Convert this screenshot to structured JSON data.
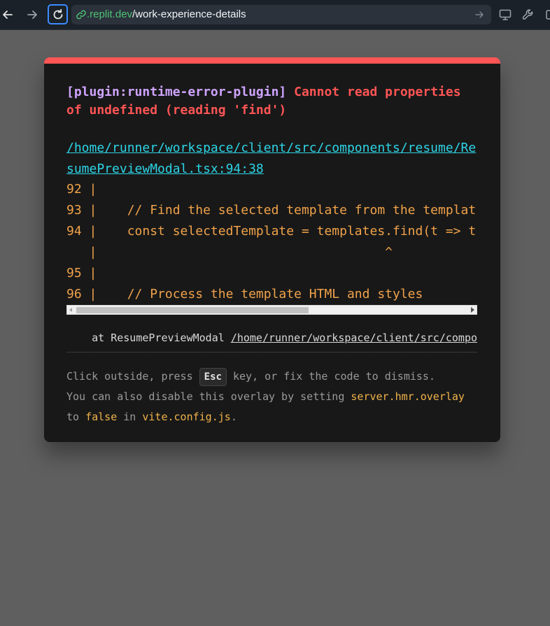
{
  "browser": {
    "url_host": ".replit.dev",
    "url_path": "/work-experience-details"
  },
  "overlay": {
    "plugin": "[plugin:runtime-error-plugin]",
    "message": "Cannot read properties of undefined (reading 'find')",
    "file": "/home/runner/workspace/client/src/components/resume/ResumePreviewModal.tsx:94:38",
    "code_frame": [
      "92 |",
      "93 |    // Find the selected template from the templat",
      "94 |    const selectedTemplate = templates.find(t => t",
      "   |                                      ^",
      "95 |",
      "96 |    // Process the template HTML and styles"
    ],
    "stack_prefix": "    at ResumePreviewModal ",
    "stack_file": "/home/runner/workspace/client/src/compor",
    "tip_line1_pre": "Click outside, press ",
    "tip_key": "Esc",
    "tip_line1_post": " key, or fix the code to dismiss.",
    "tip_line2_pre": "You can also disable this overlay by setting ",
    "tip_setting": "server.hmr.overlay",
    "tip_line3_pre": "to ",
    "tip_false": "false",
    "tip_in": " in ",
    "tip_config": "vite.config.js",
    "tip_end": "."
  },
  "colors": {
    "error_red": "#ff5555",
    "plugin_purple": "#cfa4ff",
    "link_cyan": "#2dd4e6",
    "code_orange": "#f0a24a",
    "url_green": "#4ec272"
  },
  "icons": [
    "back-arrow-icon",
    "forward-arrow-icon",
    "reload-icon",
    "link-icon",
    "go-arrow-icon",
    "monitor-icon",
    "wrench-icon",
    "new-tab-icon"
  ]
}
